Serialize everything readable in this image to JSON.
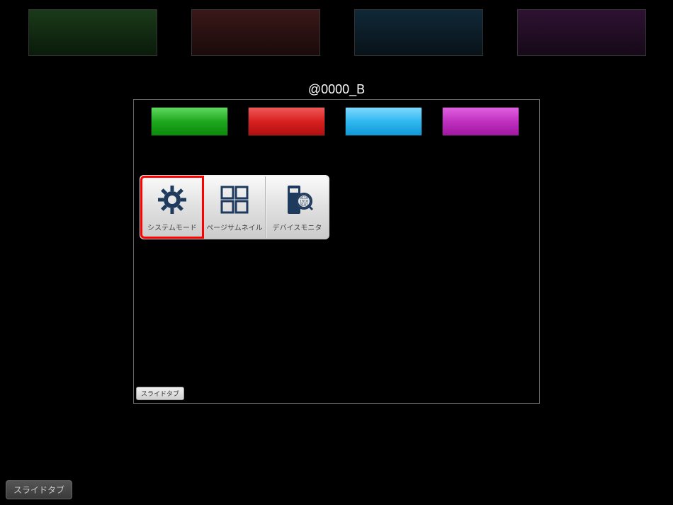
{
  "title": "@0000_B",
  "topSwatches": [
    {
      "name": "green"
    },
    {
      "name": "red"
    },
    {
      "name": "blue"
    },
    {
      "name": "purple"
    }
  ],
  "colorButtons": [
    {
      "name": "green"
    },
    {
      "name": "red"
    },
    {
      "name": "blue"
    },
    {
      "name": "magenta"
    }
  ],
  "toolbar": {
    "systemMode": {
      "label": "システムモード",
      "selected": true
    },
    "pageThumbnail": {
      "label": "ページサムネイル",
      "selected": false
    },
    "deviceMonitor": {
      "label": "デバイスモニタ",
      "selected": false
    }
  },
  "slideTabInner": "スライドタブ",
  "slideTabOuter": "スライドタブ",
  "colors": {
    "iconDark": "#1e3a5c"
  }
}
